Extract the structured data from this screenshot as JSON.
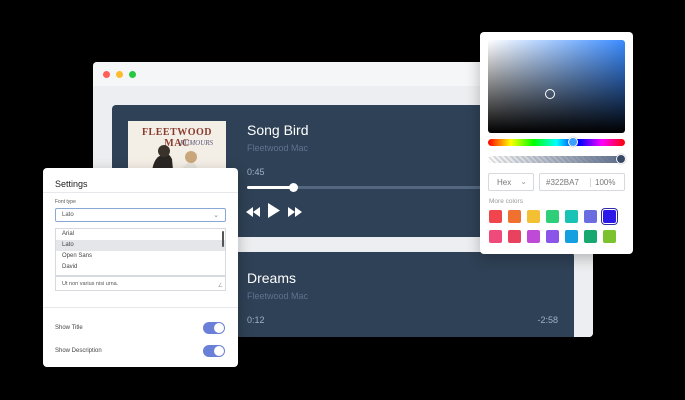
{
  "window": {
    "dots": [
      "#ff5f57",
      "#febc2e",
      "#28c840"
    ]
  },
  "player": {
    "tracks": [
      {
        "title": "Song Bird",
        "artist": "Fleetwood Mac",
        "time_elapsed": "0:45",
        "progress": 0.14
      },
      {
        "title": "Dreams",
        "artist": "Fleetwood Mac",
        "time_elapsed": "0:12",
        "time_remaining": "-2:58"
      }
    ],
    "cover": {
      "title": "FLEETWOOD MAC",
      "subtitle": "RUMOURS"
    },
    "controls": [
      "rewind-icon",
      "play-icon",
      "fast-forward-icon"
    ]
  },
  "settings": {
    "title": "Settings",
    "font_type_label": "Font type",
    "font_selected": "Lato",
    "font_options": [
      "Arial",
      "Lato",
      "Open Sans",
      "David"
    ],
    "font_highlighted": "Lato",
    "text_value": "Ut non varius nisi urna.",
    "toggles": [
      {
        "label": "Show Title",
        "on": true
      },
      {
        "label": "Show Description",
        "on": true
      }
    ]
  },
  "color_picker": {
    "format": "Hex",
    "hex": "#322BA7",
    "alpha": "100%",
    "more_colors_label": "More colors",
    "swatches": [
      "#f0454d",
      "#f0702f",
      "#f3c034",
      "#2fcf79",
      "#18c2b4",
      "#6a6ce0",
      "#2b17e8",
      "#f04a7a",
      "#e8425f",
      "#c04ad8",
      "#8a55e8",
      "#149fe0",
      "#17a872",
      "#7cc22e"
    ],
    "active_swatch": "#2b17e8"
  }
}
